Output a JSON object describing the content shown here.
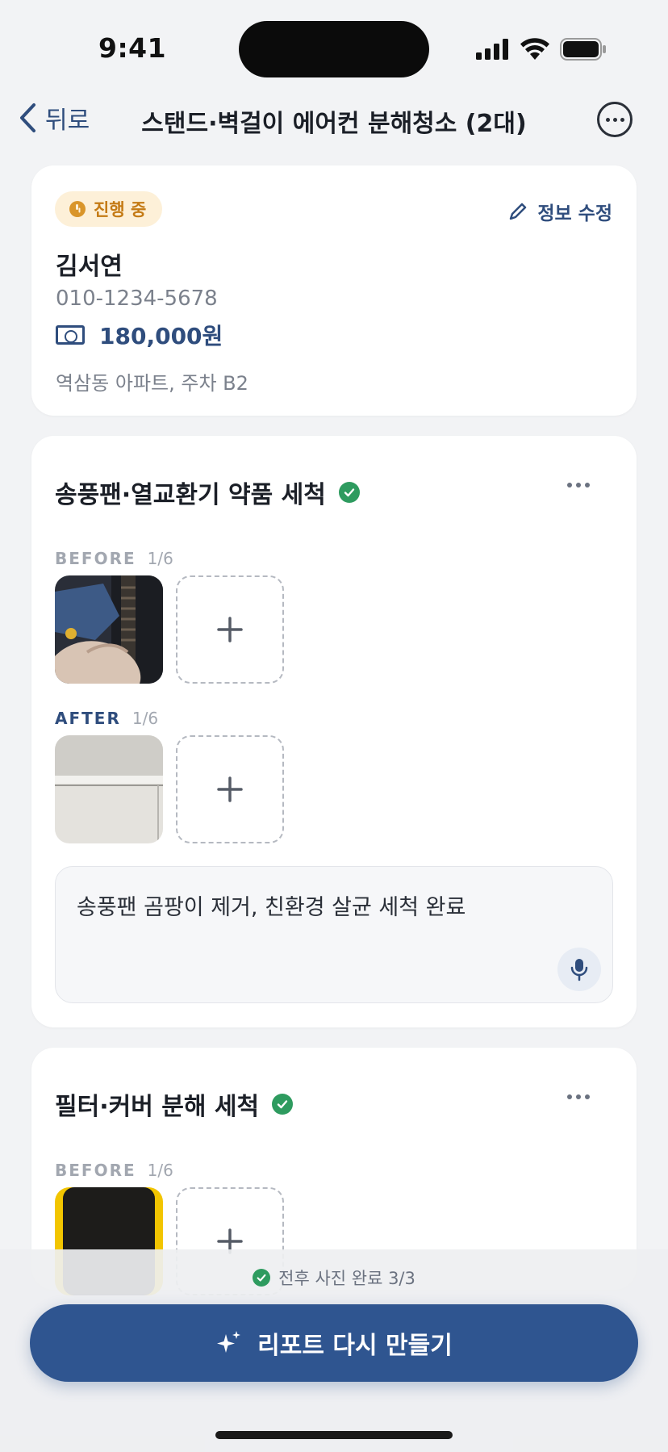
{
  "status_bar": {
    "time": "9:41"
  },
  "nav": {
    "back_label": "뒤로",
    "title": "스탠드·벽걸이 에어컨 분해청소 (2대)"
  },
  "customer": {
    "status_badge": "진행 중",
    "edit_label": "정보 수정",
    "name": "김서연",
    "phone": "010-1234-5678",
    "price": "180,000원",
    "address": "역삼동 아파트, 주차 B2"
  },
  "sections": [
    {
      "title": "송풍팬·열교환기 약품 세척",
      "before_label": "BEFORE",
      "before_count": "1/6",
      "after_label": "AFTER",
      "after_count": "1/6",
      "note": "송풍팬 곰팡이 제거, 친환경 살균 세척 완료"
    },
    {
      "title": "필터·커버 분해 세척",
      "before_label": "BEFORE",
      "before_count": "1/6"
    }
  ],
  "footer": {
    "progress_text": "전후 사진 완료 3/3",
    "cta_label": "리포트 다시 만들기"
  },
  "colors": {
    "accent": "#2f4d7d",
    "cta": "#2f5590",
    "success": "#2e9b5f",
    "badge_bg": "#fdf0d8",
    "badge_text": "#c47a14"
  }
}
